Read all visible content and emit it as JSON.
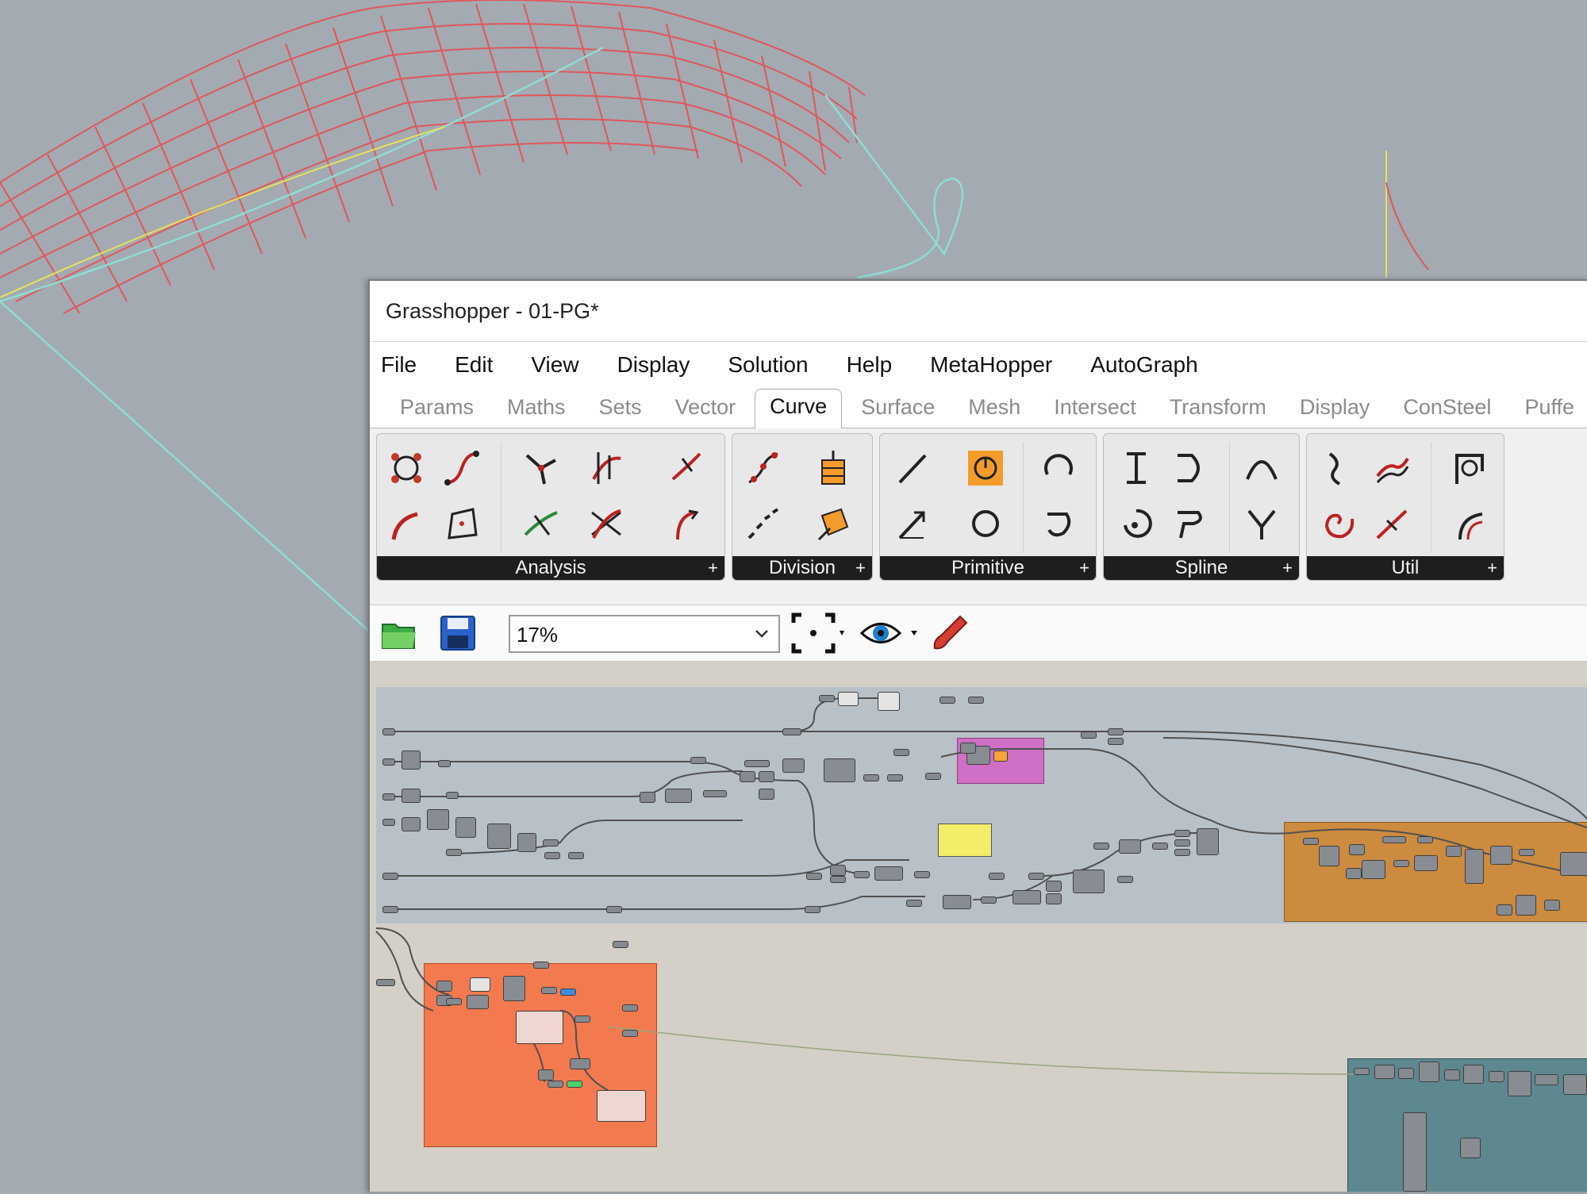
{
  "window": {
    "title": "Grasshopper - 01-PG*"
  },
  "menu": [
    "File",
    "Edit",
    "View",
    "Display",
    "Solution",
    "Help",
    "MetaHopper",
    "AutoGraph"
  ],
  "tabs": [
    "Params",
    "Maths",
    "Sets",
    "Vector",
    "Curve",
    "Surface",
    "Mesh",
    "Intersect",
    "Transform",
    "Display",
    "ConSteel",
    "Puffe"
  ],
  "active_tab": "Curve",
  "ribbon_panels": {
    "analysis": {
      "label": "Analysis",
      "expand": "+"
    },
    "division": {
      "label": "Division",
      "expand": "+"
    },
    "primitive": {
      "label": "Primitive",
      "expand": "+"
    },
    "spline": {
      "label": "Spline",
      "expand": "+"
    },
    "util": {
      "label": "Util",
      "expand": "+"
    }
  },
  "canvas_toolbar": {
    "zoom": "17%",
    "icons": [
      "open-file-icon",
      "save-file-icon",
      "zoom-extents-icon",
      "preview-eye-icon",
      "sketch-pen-icon"
    ]
  },
  "colors": {
    "viewport_bg": "#a3aab2",
    "surface_wire": "#e0575a",
    "cyan_curve": "#8fdcd4",
    "group_gray": "#b9c1c8",
    "group_orange": "#cc8b3e",
    "group_red_orange": "#f37a4f",
    "group_teal": "#5d8890",
    "group_magenta": "#cf6fc5",
    "group_yellow": "#f2ee6a",
    "canvas_bg": "#d4d0c8"
  }
}
